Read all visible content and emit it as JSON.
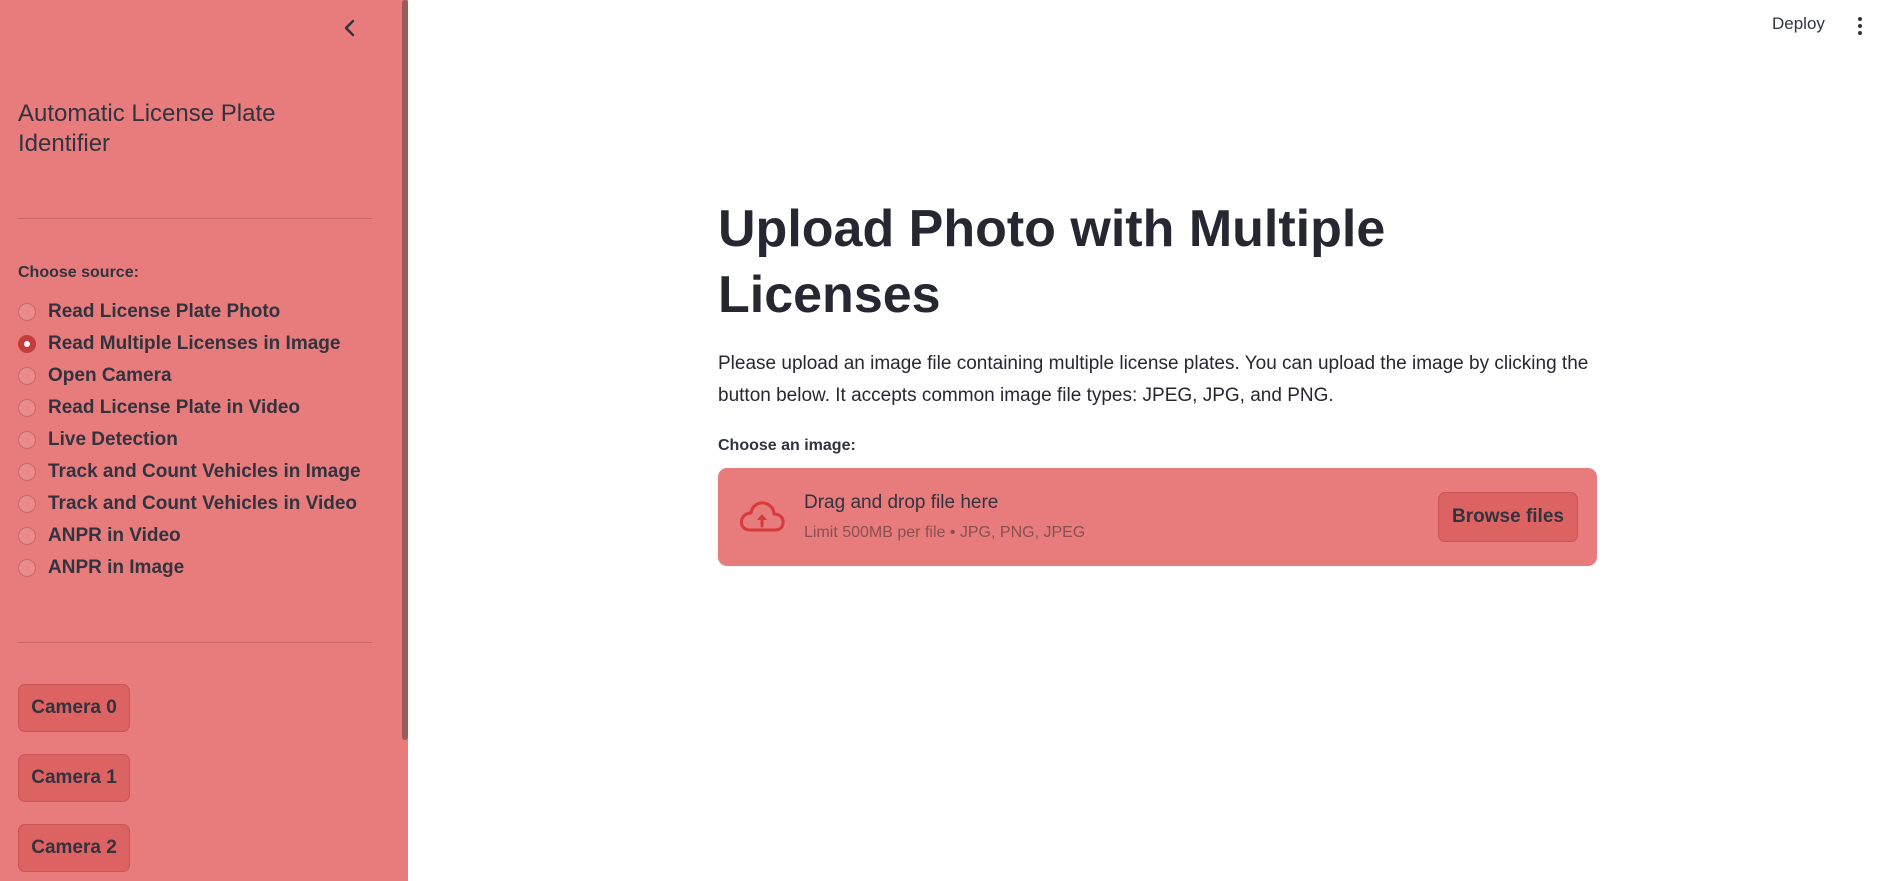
{
  "sidebar": {
    "app_title": "Automatic License Plate Identifier",
    "source_label": "Choose source:",
    "options": [
      {
        "label": "Read License Plate Photo",
        "selected": false
      },
      {
        "label": "Read Multiple Licenses in Image",
        "selected": true
      },
      {
        "label": "Open Camera",
        "selected": false
      },
      {
        "label": "Read License Plate in Video",
        "selected": false
      },
      {
        "label": "Live Detection",
        "selected": false
      },
      {
        "label": "Track and Count Vehicles in Image",
        "selected": false
      },
      {
        "label": "Track and Count Vehicles in Video",
        "selected": false
      },
      {
        "label": "ANPR in Video",
        "selected": false
      },
      {
        "label": "ANPR in Image",
        "selected": false
      }
    ],
    "camera_buttons": [
      "Camera 0",
      "Camera 1",
      "Camera 2"
    ],
    "collapse_icon": "chevron-left-icon"
  },
  "header": {
    "deploy_label": "Deploy",
    "menu_icon": "more-vertical-icon"
  },
  "main": {
    "title": "Upload Photo with Multiple Licenses",
    "description": "Please upload an image file containing multiple license plates. You can upload the image by clicking the button below. It accepts common image file types: JPEG, JPG, and PNG.",
    "uploader": {
      "label": "Choose an image:",
      "drop_text": "Drag and drop file here",
      "limit_text": "Limit 500MB per file • JPG, PNG, JPEG",
      "browse_label": "Browse files",
      "icon": "cloud-upload-icon"
    }
  },
  "colors": {
    "sidebar_bg": "#e87c7c",
    "accent": "#d63a3a",
    "button_bg": "#dd6262"
  }
}
